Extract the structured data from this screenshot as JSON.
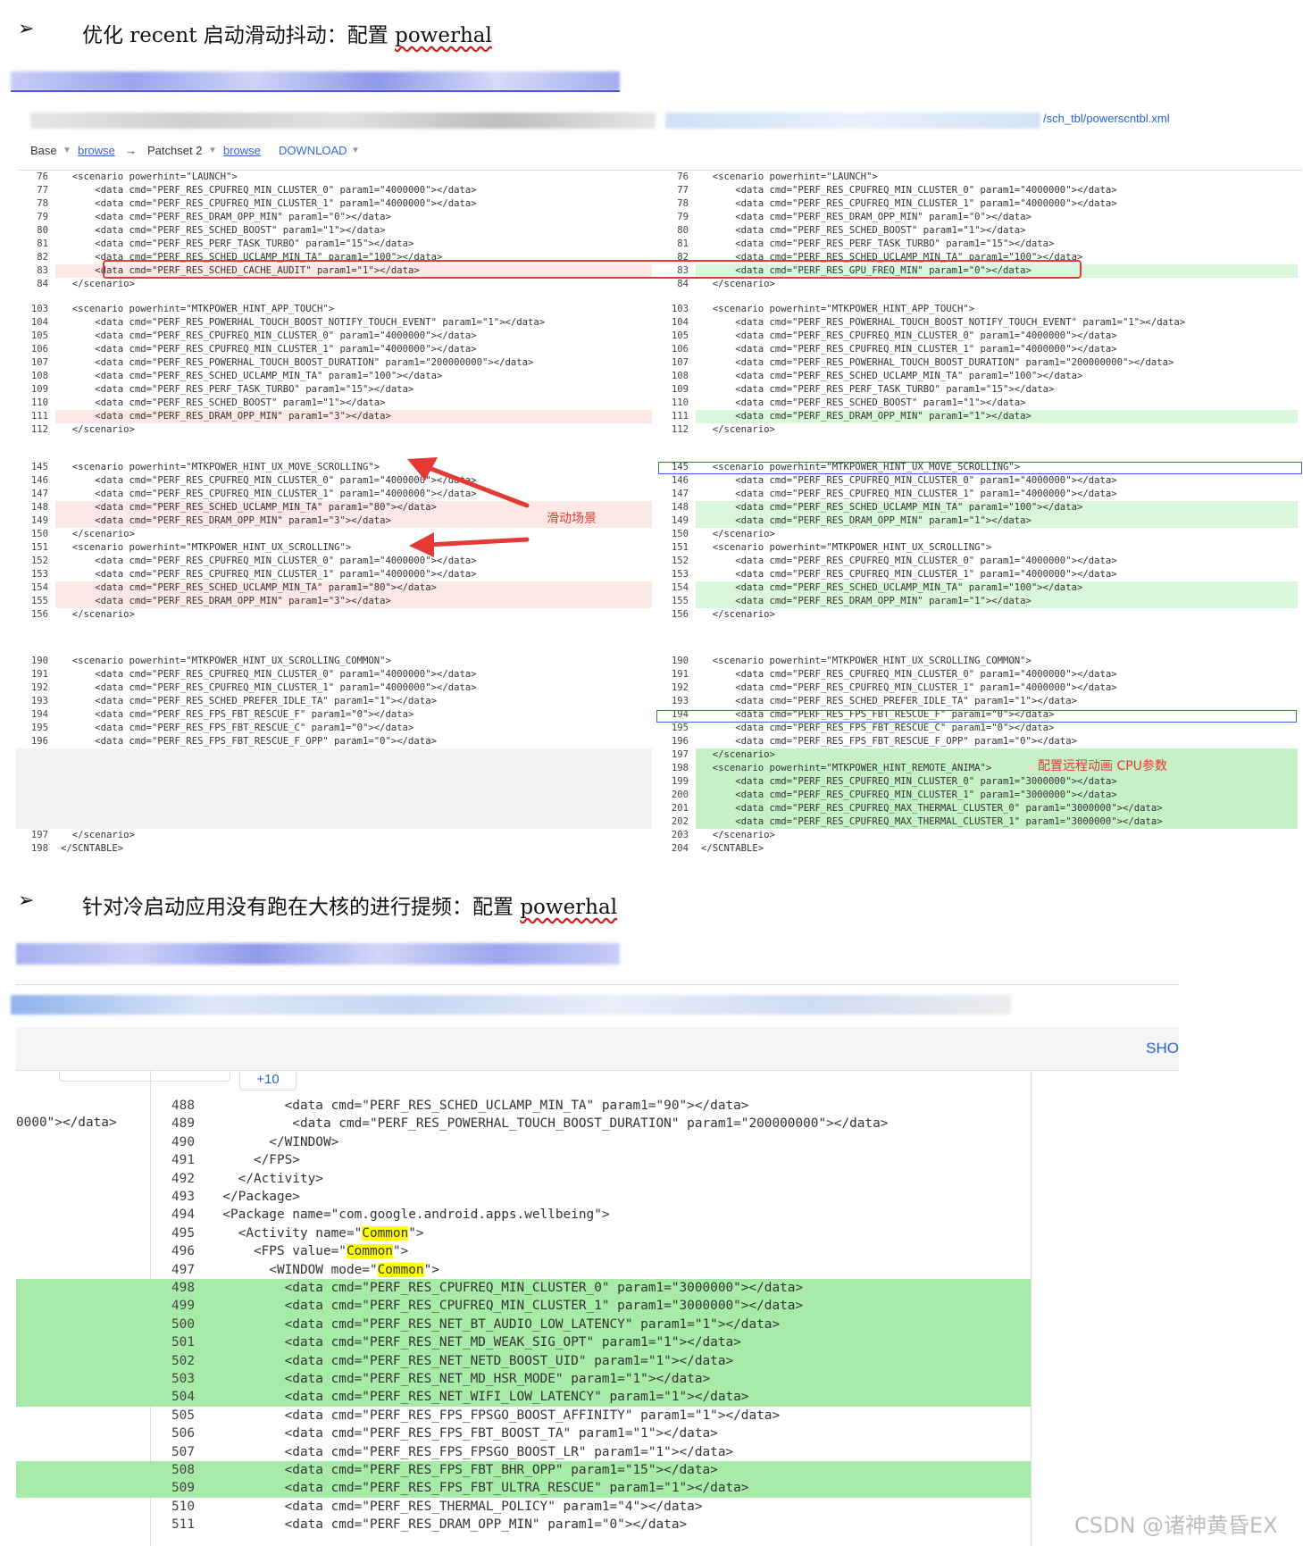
{
  "section1": {
    "bullet": "➢",
    "title": "优化 recent 启动滑动抖动：配置 ",
    "title_word": "powerhal"
  },
  "section2": {
    "bullet": "➢",
    "title": "针对冷启动应用没有跑在大核的进行提频：配置 ",
    "title_word": "powerhal"
  },
  "path_text": "/sch_tbl/powerscntbl.xml",
  "toolbar": {
    "base": "Base",
    "browse1": "browse",
    "arrow": "→",
    "patchset": "Patchset 2",
    "browse2": "browse",
    "download": "DOWNLOAD"
  },
  "callouts": {
    "scroll": "滑动场景",
    "remote": "配置远程动画 CPU参数"
  },
  "diff_left": [
    {
      "n": "76",
      "t": "  <scenario powerhint=\"LAUNCH\">",
      "c": ""
    },
    {
      "n": "77",
      "t": "      <data cmd=\"PERF_RES_CPUFREQ_MIN_CLUSTER_0\" param1=\"4000000\"></data>",
      "c": ""
    },
    {
      "n": "78",
      "t": "      <data cmd=\"PERF_RES_CPUFREQ_MIN_CLUSTER_1\" param1=\"4000000\"></data>",
      "c": ""
    },
    {
      "n": "79",
      "t": "      <data cmd=\"PERF_RES_DRAM_OPP_MIN\" param1=\"0\"></data>",
      "c": ""
    },
    {
      "n": "80",
      "t": "      <data cmd=\"PERF_RES_SCHED_BOOST\" param1=\"1\"></data>",
      "c": ""
    },
    {
      "n": "81",
      "t": "      <data cmd=\"PERF_RES_PERF_TASK_TURBO\" param1=\"15\"></data>",
      "c": ""
    },
    {
      "n": "82",
      "t": "      <data cmd=\"PERF_RES_SCHED_UCLAMP_MIN_TA\" param1=\"100\"></data>",
      "c": ""
    },
    {
      "n": "83",
      "t": "      <data cmd=\"PERF_RES_SCHED_CACHE_AUDIT\" param1=\"1\"></data>",
      "c": "del"
    },
    {
      "n": "84",
      "t": "  </scenario>",
      "c": ""
    }
  ],
  "diff_right": [
    {
      "n": "76",
      "t": "  <scenario powerhint=\"LAUNCH\">",
      "c": ""
    },
    {
      "n": "77",
      "t": "      <data cmd=\"PERF_RES_CPUFREQ_MIN_CLUSTER_0\" param1=\"4000000\"></data>",
      "c": ""
    },
    {
      "n": "78",
      "t": "      <data cmd=\"PERF_RES_CPUFREQ_MIN_CLUSTER_1\" param1=\"4000000\"></data>",
      "c": ""
    },
    {
      "n": "79",
      "t": "      <data cmd=\"PERF_RES_DRAM_OPP_MIN\" param1=\"0\"></data>",
      "c": ""
    },
    {
      "n": "80",
      "t": "      <data cmd=\"PERF_RES_SCHED_BOOST\" param1=\"1\"></data>",
      "c": ""
    },
    {
      "n": "81",
      "t": "      <data cmd=\"PERF_RES_PERF_TASK_TURBO\" param1=\"15\"></data>",
      "c": ""
    },
    {
      "n": "82",
      "t": "      <data cmd=\"PERF_RES_SCHED_UCLAMP_MIN_TA\" param1=\"100\"></data>",
      "c": ""
    },
    {
      "n": "83",
      "t": "      <data cmd=\"PERF_RES_GPU_FREQ_MIN\" param1=\"0\"></data>",
      "c": "add"
    },
    {
      "n": "84",
      "t": "  </scenario>",
      "c": ""
    }
  ],
  "diff2_left": [
    {
      "n": "103",
      "t": "  <scenario powerhint=\"MTKPOWER_HINT_APP_TOUCH\">",
      "c": ""
    },
    {
      "n": "104",
      "t": "      <data cmd=\"PERF_RES_POWERHAL_TOUCH_BOOST_NOTIFY_TOUCH_EVENT\" param1=\"1\"></data>",
      "c": ""
    },
    {
      "n": "105",
      "t": "      <data cmd=\"PERF_RES_CPUFREQ_MIN_CLUSTER_0\" param1=\"4000000\"></data>",
      "c": ""
    },
    {
      "n": "106",
      "t": "      <data cmd=\"PERF_RES_CPUFREQ_MIN_CLUSTER_1\" param1=\"4000000\"></data>",
      "c": ""
    },
    {
      "n": "107",
      "t": "      <data cmd=\"PERF_RES_POWERHAL_TOUCH_BOOST_DURATION\" param1=\"200000000\"></data>",
      "c": ""
    },
    {
      "n": "108",
      "t": "      <data cmd=\"PERF_RES_SCHED_UCLAMP_MIN_TA\" param1=\"100\"></data>",
      "c": ""
    },
    {
      "n": "109",
      "t": "      <data cmd=\"PERF_RES_PERF_TASK_TURBO\" param1=\"15\"></data>",
      "c": ""
    },
    {
      "n": "110",
      "t": "      <data cmd=\"PERF_RES_SCHED_BOOST\" param1=\"1\"></data>",
      "c": ""
    },
    {
      "n": "111",
      "t": "      <data cmd=\"PERF_RES_DRAM_OPP_MIN\" param1=\"3\"></data>",
      "c": "del"
    },
    {
      "n": "112",
      "t": "  </scenario>",
      "c": ""
    }
  ],
  "diff2_right": [
    {
      "n": "103",
      "t": "  <scenario powerhint=\"MTKPOWER_HINT_APP_TOUCH\">",
      "c": ""
    },
    {
      "n": "104",
      "t": "      <data cmd=\"PERF_RES_POWERHAL_TOUCH_BOOST_NOTIFY_TOUCH_EVENT\" param1=\"1\"></data>",
      "c": ""
    },
    {
      "n": "105",
      "t": "      <data cmd=\"PERF_RES_CPUFREQ_MIN_CLUSTER_0\" param1=\"4000000\"></data>",
      "c": ""
    },
    {
      "n": "106",
      "t": "      <data cmd=\"PERF_RES_CPUFREQ_MIN_CLUSTER_1\" param1=\"4000000\"></data>",
      "c": ""
    },
    {
      "n": "107",
      "t": "      <data cmd=\"PERF_RES_POWERHAL_TOUCH_BOOST_DURATION\" param1=\"200000000\"></data>",
      "c": ""
    },
    {
      "n": "108",
      "t": "      <data cmd=\"PERF_RES_SCHED_UCLAMP_MIN_TA\" param1=\"100\"></data>",
      "c": ""
    },
    {
      "n": "109",
      "t": "      <data cmd=\"PERF_RES_PERF_TASK_TURBO\" param1=\"15\"></data>",
      "c": ""
    },
    {
      "n": "110",
      "t": "      <data cmd=\"PERF_RES_SCHED_BOOST\" param1=\"1\"></data>",
      "c": ""
    },
    {
      "n": "111",
      "t": "      <data cmd=\"PERF_RES_DRAM_OPP_MIN\" param1=\"1\"></data>",
      "c": "add"
    },
    {
      "n": "112",
      "t": "  </scenario>",
      "c": ""
    }
  ],
  "diff3_left": [
    {
      "n": "145",
      "t": "  <scenario powerhint=\"MTKPOWER_HINT_UX_MOVE_SCROLLING\">",
      "c": ""
    },
    {
      "n": "146",
      "t": "      <data cmd=\"PERF_RES_CPUFREQ_MIN_CLUSTER_0\" param1=\"4000000\"></data>",
      "c": ""
    },
    {
      "n": "147",
      "t": "      <data cmd=\"PERF_RES_CPUFREQ_MIN_CLUSTER_1\" param1=\"4000000\"></data>",
      "c": ""
    },
    {
      "n": "148",
      "t": "      <data cmd=\"PERF_RES_SCHED_UCLAMP_MIN_TA\" param1=\"80\"></data>",
      "c": "del"
    },
    {
      "n": "149",
      "t": "      <data cmd=\"PERF_RES_DRAM_OPP_MIN\" param1=\"3\"></data>",
      "c": "del"
    },
    {
      "n": "150",
      "t": "  </scenario>",
      "c": ""
    },
    {
      "n": "151",
      "t": "  <scenario powerhint=\"MTKPOWER_HINT_UX_SCROLLING\">",
      "c": ""
    },
    {
      "n": "152",
      "t": "      <data cmd=\"PERF_RES_CPUFREQ_MIN_CLUSTER_0\" param1=\"4000000\"></data>",
      "c": ""
    },
    {
      "n": "153",
      "t": "      <data cmd=\"PERF_RES_CPUFREQ_MIN_CLUSTER_1\" param1=\"4000000\"></data>",
      "c": ""
    },
    {
      "n": "154",
      "t": "      <data cmd=\"PERF_RES_SCHED_UCLAMP_MIN_TA\" param1=\"80\"></data>",
      "c": "del"
    },
    {
      "n": "155",
      "t": "      <data cmd=\"PERF_RES_DRAM_OPP_MIN\" param1=\"3\"></data>",
      "c": "del"
    },
    {
      "n": "156",
      "t": "  </scenario>",
      "c": ""
    }
  ],
  "diff3_right": [
    {
      "n": "145",
      "t": "  <scenario powerhint=\"MTKPOWER_HINT_UX_MOVE_SCROLLING\">",
      "c": ""
    },
    {
      "n": "146",
      "t": "      <data cmd=\"PERF_RES_CPUFREQ_MIN_CLUSTER_0\" param1=\"4000000\"></data>",
      "c": ""
    },
    {
      "n": "147",
      "t": "      <data cmd=\"PERF_RES_CPUFREQ_MIN_CLUSTER_1\" param1=\"4000000\"></data>",
      "c": ""
    },
    {
      "n": "148",
      "t": "      <data cmd=\"PERF_RES_SCHED_UCLAMP_MIN_TA\" param1=\"100\"></data>",
      "c": "add"
    },
    {
      "n": "149",
      "t": "      <data cmd=\"PERF_RES_DRAM_OPP_MIN\" param1=\"1\"></data>",
      "c": "add"
    },
    {
      "n": "150",
      "t": "  </scenario>",
      "c": ""
    },
    {
      "n": "151",
      "t": "  <scenario powerhint=\"MTKPOWER_HINT_UX_SCROLLING\">",
      "c": ""
    },
    {
      "n": "152",
      "t": "      <data cmd=\"PERF_RES_CPUFREQ_MIN_CLUSTER_0\" param1=\"4000000\"></data>",
      "c": ""
    },
    {
      "n": "153",
      "t": "      <data cmd=\"PERF_RES_CPUFREQ_MIN_CLUSTER_1\" param1=\"4000000\"></data>",
      "c": ""
    },
    {
      "n": "154",
      "t": "      <data cmd=\"PERF_RES_SCHED_UCLAMP_MIN_TA\" param1=\"100\"></data>",
      "c": "add"
    },
    {
      "n": "155",
      "t": "      <data cmd=\"PERF_RES_DRAM_OPP_MIN\" param1=\"1\"></data>",
      "c": "add"
    },
    {
      "n": "156",
      "t": "  </scenario>",
      "c": ""
    }
  ],
  "diff4_left": [
    {
      "n": "190",
      "t": "  <scenario powerhint=\"MTKPOWER_HINT_UX_SCROLLING_COMMON\">",
      "c": ""
    },
    {
      "n": "191",
      "t": "      <data cmd=\"PERF_RES_CPUFREQ_MIN_CLUSTER_0\" param1=\"4000000\"></data>",
      "c": ""
    },
    {
      "n": "192",
      "t": "      <data cmd=\"PERF_RES_CPUFREQ_MIN_CLUSTER_1\" param1=\"4000000\"></data>",
      "c": ""
    },
    {
      "n": "193",
      "t": "      <data cmd=\"PERF_RES_SCHED_PREFER_IDLE_TA\" param1=\"1\"></data>",
      "c": ""
    },
    {
      "n": "194",
      "t": "      <data cmd=\"PERF_RES_FPS_FBT_RESCUE_F\" param1=\"0\"></data>",
      "c": ""
    },
    {
      "n": "195",
      "t": "      <data cmd=\"PERF_RES_FPS_FBT_RESCUE_C\" param1=\"0\"></data>",
      "c": ""
    },
    {
      "n": "196",
      "t": "      <data cmd=\"PERF_RES_FPS_FBT_RESCUE_F_OPP\" param1=\"0\"></data>",
      "c": ""
    }
  ],
  "diff4_left_tail": [
    {
      "n": "197",
      "t": "  </scenario>",
      "c": ""
    },
    {
      "n": "198",
      "t": "</SCNTABLE>",
      "c": ""
    }
  ],
  "diff4_right": [
    {
      "n": "190",
      "t": "  <scenario powerhint=\"MTKPOWER_HINT_UX_SCROLLING_COMMON\">",
      "c": ""
    },
    {
      "n": "191",
      "t": "      <data cmd=\"PERF_RES_CPUFREQ_MIN_CLUSTER_0\" param1=\"4000000\"></data>",
      "c": ""
    },
    {
      "n": "192",
      "t": "      <data cmd=\"PERF_RES_CPUFREQ_MIN_CLUSTER_1\" param1=\"4000000\"></data>",
      "c": ""
    },
    {
      "n": "193",
      "t": "      <data cmd=\"PERF_RES_SCHED_PREFER_IDLE_TA\" param1=\"1\"></data>",
      "c": ""
    },
    {
      "n": "194",
      "t": "      <data cmd=\"PERF_RES_FPS_FBT_RESCUE_F\" param1=\"0\"></data>",
      "c": ""
    },
    {
      "n": "195",
      "t": "      <data cmd=\"PERF_RES_FPS_FBT_RESCUE_C\" param1=\"0\"></data>",
      "c": ""
    },
    {
      "n": "196",
      "t": "      <data cmd=\"PERF_RES_FPS_FBT_RESCUE_F_OPP\" param1=\"0\"></data>",
      "c": ""
    },
    {
      "n": "197",
      "t": "  </scenario>",
      "c": "addg"
    },
    {
      "n": "198",
      "t": "  <scenario powerhint=\"MTKPOWER_HINT_REMOTE_ANIMA\">",
      "c": "addg"
    },
    {
      "n": "199",
      "t": "      <data cmd=\"PERF_RES_CPUFREQ_MIN_CLUSTER_0\" param1=\"3000000\"></data>",
      "c": "addg"
    },
    {
      "n": "200",
      "t": "      <data cmd=\"PERF_RES_CPUFREQ_MIN_CLUSTER_1\" param1=\"3000000\"></data>",
      "c": "addg"
    },
    {
      "n": "201",
      "t": "      <data cmd=\"PERF_RES_CPUFREQ_MAX_THERMAL_CLUSTER_0\" param1=\"3000000\"></data>",
      "c": "addg"
    },
    {
      "n": "202",
      "t": "      <data cmd=\"PERF_RES_CPUFREQ_MAX_THERMAL_CLUSTER_1\" param1=\"3000000\"></data>",
      "c": "addg"
    },
    {
      "n": "203",
      "t": "  </scenario>",
      "c": ""
    },
    {
      "n": "204",
      "t": "</SCNTABLE>",
      "c": ""
    }
  ],
  "bottom": {
    "show_label": "SHO",
    "expand_label": "+10",
    "left_fragment": "0000\"></data>",
    "watermark": "CSDN @诸神黄昏EX",
    "rows": [
      {
        "n": "488",
        "t": "          <data cmd=\"PERF_RES_SCHED_UCLAMP_MIN_TA\" param1=\"90\"></data>",
        "c": ""
      },
      {
        "n": "489",
        "t": "           <data cmd=\"PERF_RES_POWERHAL_TOUCH_BOOST_DURATION\" param1=\"200000000\"></data>",
        "c": ""
      },
      {
        "n": "490",
        "t": "        </WINDOW>",
        "c": ""
      },
      {
        "n": "491",
        "t": "      </FPS>",
        "c": ""
      },
      {
        "n": "492",
        "t": "    </Activity>",
        "c": ""
      },
      {
        "n": "493",
        "t": "  </Package>",
        "c": ""
      },
      {
        "n": "494",
        "t": "  <Package name=\"com.google.android.apps.wellbeing\">",
        "c": ""
      },
      {
        "n": "495",
        "t": "    <Activity name=\"Common\">",
        "c": ""
      },
      {
        "n": "496",
        "t": "      <FPS value=\"Common\">",
        "c": ""
      },
      {
        "n": "497",
        "t": "        <WINDOW mode=\"Common\">",
        "c": ""
      },
      {
        "n": "498",
        "t": "          <data cmd=\"PERF_RES_CPUFREQ_MIN_CLUSTER_0\" param1=\"3000000\"></data>",
        "c": "g"
      },
      {
        "n": "499",
        "t": "          <data cmd=\"PERF_RES_CPUFREQ_MIN_CLUSTER_1\" param1=\"3000000\"></data>",
        "c": "g"
      },
      {
        "n": "500",
        "t": "          <data cmd=\"PERF_RES_NET_BT_AUDIO_LOW_LATENCY\" param1=\"1\"></data>",
        "c": "g"
      },
      {
        "n": "501",
        "t": "          <data cmd=\"PERF_RES_NET_MD_WEAK_SIG_OPT\" param1=\"1\"></data>",
        "c": "g"
      },
      {
        "n": "502",
        "t": "          <data cmd=\"PERF_RES_NET_NETD_BOOST_UID\" param1=\"1\"></data>",
        "c": "g"
      },
      {
        "n": "503",
        "t": "          <data cmd=\"PERF_RES_NET_MD_HSR_MODE\" param1=\"1\"></data>",
        "c": "g"
      },
      {
        "n": "504",
        "t": "          <data cmd=\"PERF_RES_NET_WIFI_LOW_LATENCY\" param1=\"1\"></data>",
        "c": "g"
      },
      {
        "n": "505",
        "t": "          <data cmd=\"PERF_RES_FPS_FPSGO_BOOST_AFFINITY\" param1=\"1\"></data>",
        "c": ""
      },
      {
        "n": "506",
        "t": "          <data cmd=\"PERF_RES_FPS_FBT_BOOST_TA\" param1=\"1\"></data>",
        "c": ""
      },
      {
        "n": "507",
        "t": "          <data cmd=\"PERF_RES_FPS_FPSGO_BOOST_LR\" param1=\"1\"></data>",
        "c": ""
      },
      {
        "n": "508",
        "t": "          <data cmd=\"PERF_RES_FPS_FBT_BHR_OPP\" param1=\"15\"></data>",
        "c": "g"
      },
      {
        "n": "509",
        "t": "          <data cmd=\"PERF_RES_FPS_FBT_ULTRA_RESCUE\" param1=\"1\"></data>",
        "c": "g"
      },
      {
        "n": "510",
        "t": "          <data cmd=\"PERF_RES_THERMAL_POLICY\" param1=\"4\"></data>",
        "c": ""
      },
      {
        "n": "511",
        "t": "          <data cmd=\"PERF_RES_DRAM_OPP_MIN\" param1=\"0\"></data>",
        "c": ""
      }
    ]
  }
}
